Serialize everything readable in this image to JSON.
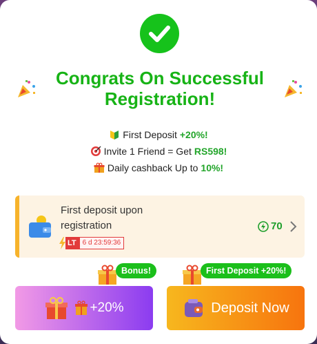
{
  "modal": {
    "title": "Congrats On Successful Registration!",
    "perks": [
      {
        "icon": "beginner-icon",
        "text": "First Deposit ",
        "highlight": "+20%!"
      },
      {
        "icon": "target-icon",
        "text": "Invite 1 Friend = Get ",
        "highlight": "RS598!"
      },
      {
        "icon": "gift-icon",
        "text": "Daily cashback Up to ",
        "highlight": "10%!"
      }
    ],
    "card": {
      "title": "First deposit upon registration",
      "badge_label": "LT",
      "timer": "6 d 23:59:36",
      "points": "70"
    },
    "buttons": {
      "bonus_label": "+20%",
      "bonus_tag": "Bonus!",
      "deposit_label": "Deposit Now",
      "deposit_tag": "First Deposit +20%!"
    }
  },
  "colors": {
    "accent_green": "#17b316",
    "highlight_green": "#22a52a",
    "card_bg": "#fdf3e3",
    "deposit_orange": "#f7740e",
    "bonus_purple": "#8b3cf0"
  }
}
